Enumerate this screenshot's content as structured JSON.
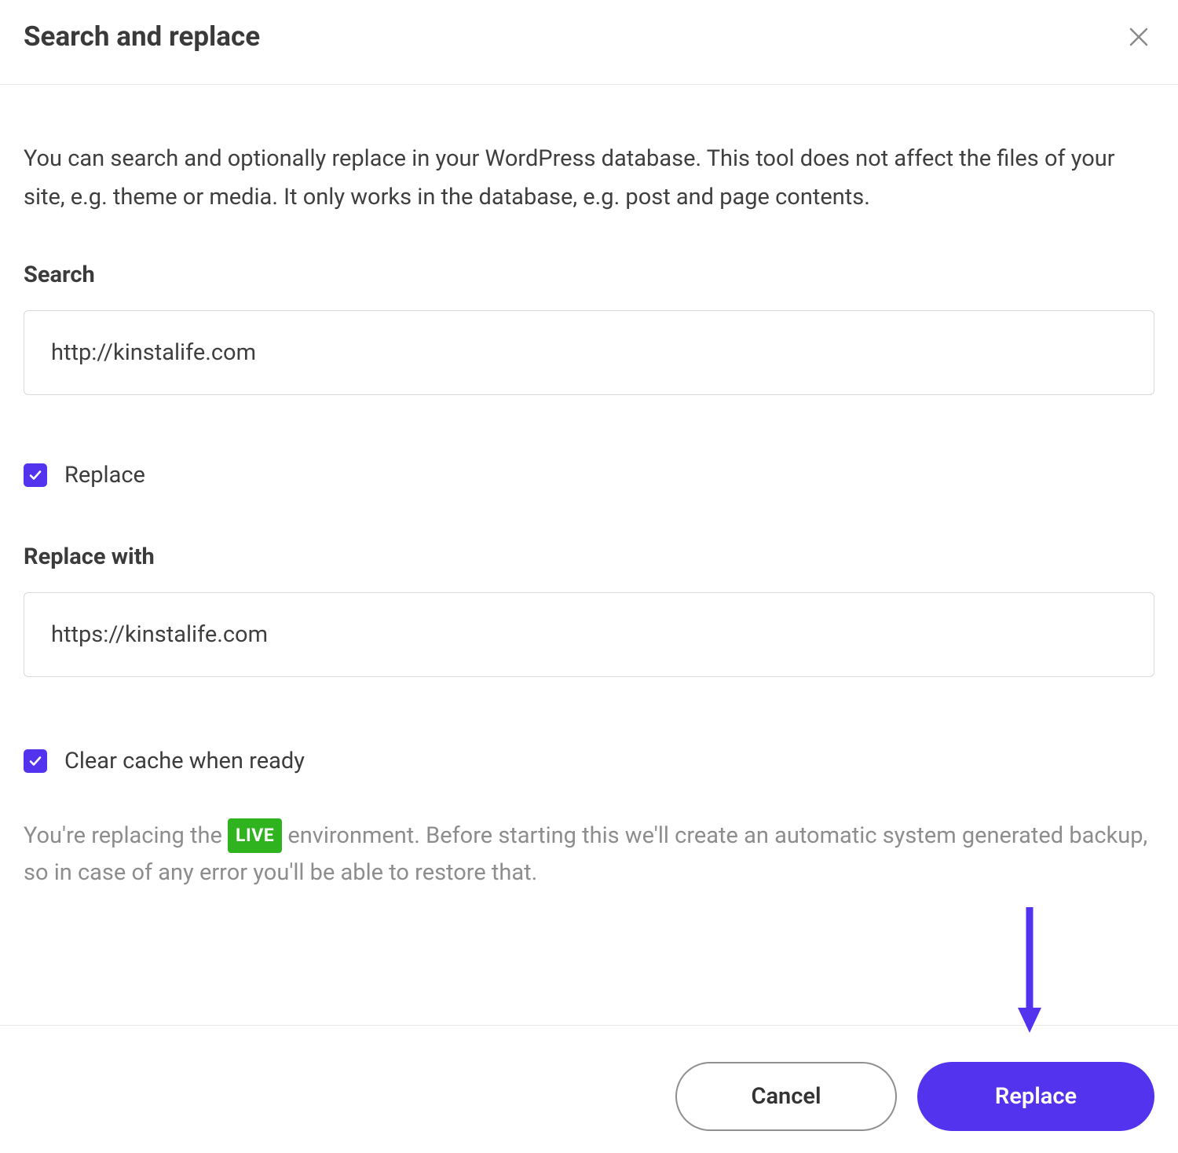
{
  "header": {
    "title": "Search and replace"
  },
  "description": "You can search and optionally replace in your WordPress database. This tool does not affect the files of your site, e.g. theme or media. It only works in the database, e.g. post and page contents.",
  "search": {
    "label": "Search",
    "value": "http://kinstalife.com"
  },
  "replace_checkbox": {
    "checked": true,
    "label": "Replace"
  },
  "replace_with": {
    "label": "Replace with",
    "value": "https://kinstalife.com"
  },
  "clear_cache_checkbox": {
    "checked": true,
    "label": "Clear cache when ready"
  },
  "note": {
    "prefix": "You're replacing the",
    "env_label": "LIVE",
    "suffix": "environment. Before starting this we'll create an automatic system generated backup, so in case of any error you'll be able to restore that."
  },
  "footer": {
    "cancel_label": "Cancel",
    "replace_label": "Replace"
  },
  "colors": {
    "accent": "#5333ed",
    "env_badge": "#2fb41f"
  }
}
